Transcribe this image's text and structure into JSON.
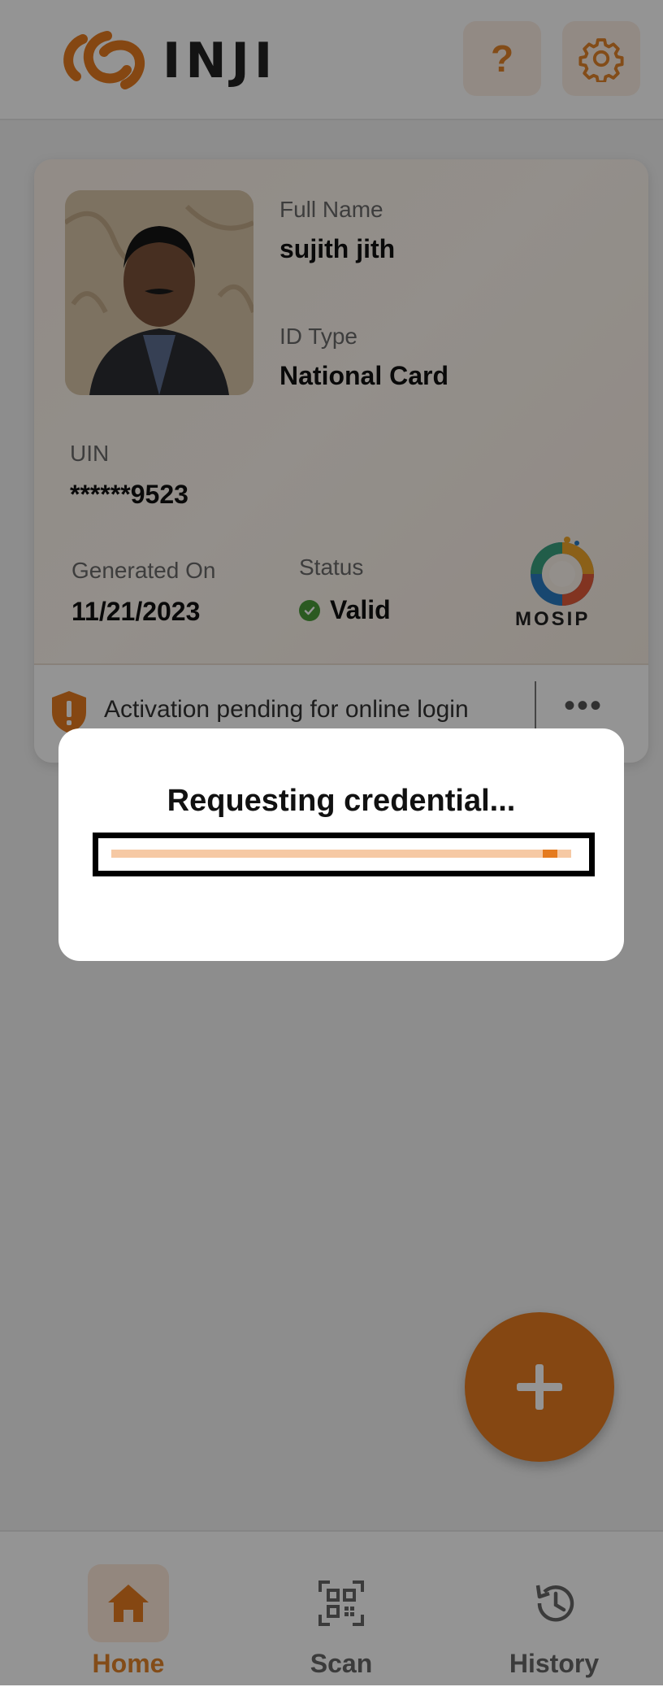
{
  "header": {
    "logo_text": "INJI",
    "help_label": "?"
  },
  "card": {
    "full_name_label": "Full Name",
    "full_name": "sujith  jith",
    "id_type_label": "ID Type",
    "id_type": "National Card",
    "uin_label": "UIN",
    "uin": "******9523",
    "generated_on_label": "Generated On",
    "generated_on": "11/21/2023",
    "status_label": "Status",
    "status": "Valid",
    "issuer_logo_text": "MOSIP",
    "activation_text": "Activation pending for online login",
    "more_label": "•••"
  },
  "fab": {
    "icon": "plus-icon"
  },
  "bottom_nav": {
    "items": [
      {
        "label": "Home",
        "icon": "home-icon",
        "active": true
      },
      {
        "label": "Scan",
        "icon": "qr-scan-icon",
        "active": false
      },
      {
        "label": "History",
        "icon": "history-icon",
        "active": false
      }
    ]
  },
  "modal": {
    "title": "Requesting credential...",
    "progress": 0.97
  },
  "colors": {
    "accent": "#e57b1f",
    "accent_light": "#fde9d9",
    "valid_green": "#4a9b3a",
    "overlay": "rgba(0,0,0,0.42)"
  }
}
